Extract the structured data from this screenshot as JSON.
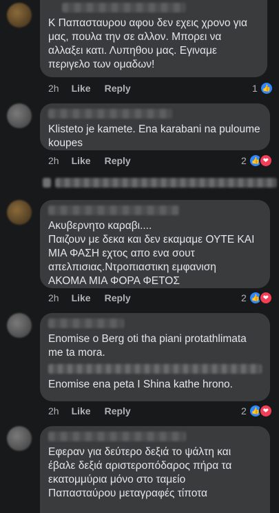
{
  "comments": [
    {
      "text": "Κ Παπασταυρου αφου δεν εχεις χρονο για\nμας, πουλα την σε αλλον. Μπορει να\nαλλαξει κατι. Λυπηθου μας. Εγιναμε\nπεριγελο των ομαδων!",
      "time": "2h",
      "like": "Like",
      "reply": "Reply",
      "reactions": "1"
    },
    {
      "text": "Klisteto je kamete. Ena karabani na puloume\nkoupes",
      "time": "2h",
      "like": "Like",
      "reply": "Reply",
      "reactions": "2"
    },
    {
      "text": "Ακυβερνητο καραβι....\nΠαιζουν με δεκα και δεν εκαμαμε ΟΥΤΕ ΚΑΙ\nΜΙΑ ΦΑΣΗ εχτος απο ενα σουτ\nαπελπισιας.Ντροπιαστικη εμφανιση\nΑΚΟΜΑ ΜΙΑ ΦΟΡΑ ΦΕΤΟΣ",
      "time": "2h",
      "like": "Like",
      "reply": "Reply",
      "reactions": "2"
    },
    {
      "text": "Enomise o Berg oti tha piani protathlimata\nme ta mora.",
      "text2": "Enomise ena peta I Shina kathe hrono.",
      "time": "2h",
      "like": "Like",
      "reply": "Reply",
      "reactions": "2"
    },
    {
      "text": "Εφεραν για δεύτερο δεξιά το ψάλτη και\nέβαλε δεξιά αριστεροπόδαρος πήρα τα\nεκατομμύρια μόνο στο ταμείο\nΠαπασταύρου μεταγραφές τίποτα"
    }
  ],
  "icons": {
    "like": "thumbs-up-icon",
    "love": "heart-icon"
  },
  "colors": {
    "bubble": "#3a3b3c",
    "background": "#18191a",
    "like": "#2d88ff",
    "love": "#f33e58"
  }
}
